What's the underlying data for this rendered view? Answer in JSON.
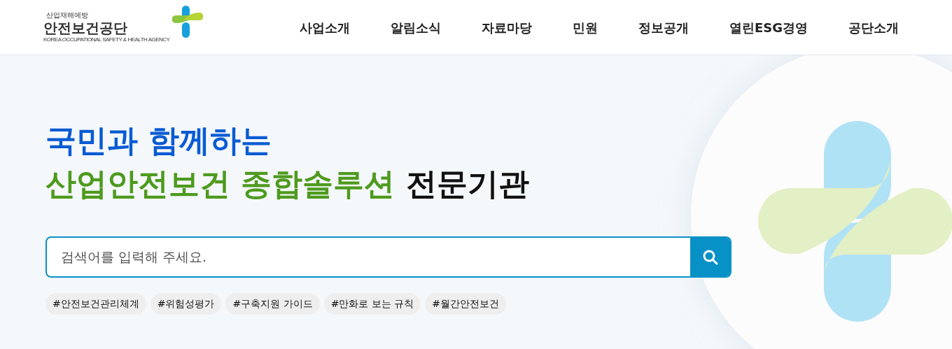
{
  "logo": {
    "tagline": "산업재해예방",
    "name": "안전보건공단",
    "english": "KOREA OCCUPATIONAL SAFETY & HEALTH AGENCY"
  },
  "nav": [
    "사업소개",
    "알림소식",
    "자료마당",
    "민원",
    "정보공개",
    "열린ESG경영",
    "공단소개"
  ],
  "headline": [
    [
      {
        "text": "국민과 함께하는",
        "color": "#0a5bd3"
      }
    ],
    [
      {
        "text": "산업안전보건 종합솔루션",
        "color": "#4e9a1e"
      },
      {
        "text": "전문기관",
        "color": "#111111"
      }
    ]
  ],
  "search": {
    "placeholder": "검색어를 입력해 주세요."
  },
  "tags": [
    "#안전보건관리체계",
    "#위험성평가",
    "#구축지원 가이드",
    "#만화로 보는 규칙",
    "#월간안전보건"
  ]
}
